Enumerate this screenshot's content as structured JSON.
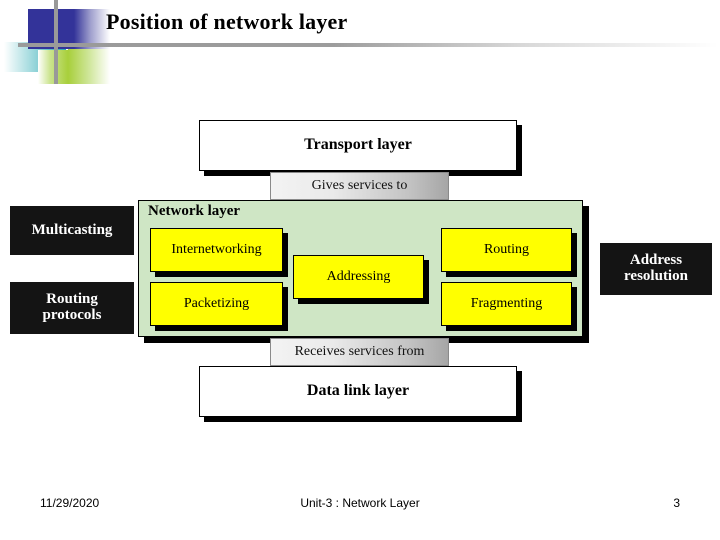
{
  "slide": {
    "title": "Position of network layer",
    "page_number": "3"
  },
  "diagram": {
    "upper_layer": "Transport layer",
    "upper_connector": "Gives services to",
    "network_layer_label": "Network layer",
    "lower_connector": "Receives services from",
    "lower_layer": "Data link layer",
    "functions": [
      {
        "label": "Internetworking"
      },
      {
        "label": "Packetizing"
      },
      {
        "label": "Addressing"
      },
      {
        "label": "Routing"
      },
      {
        "label": "Fragmenting"
      }
    ],
    "left_boxes": [
      {
        "line1": "Multicasting",
        "line2": ""
      },
      {
        "line1": "Routing",
        "line2": "protocols"
      }
    ],
    "right_boxes": [
      {
        "line1": "Address",
        "line2": "resolution"
      }
    ]
  },
  "footer": {
    "date": "11/29/2020",
    "center": "Unit-3 : Network Layer",
    "page": "3"
  },
  "colors": {
    "network_layer_fill": "#cfe6c5",
    "function_fill": "#ffff00",
    "side_box_fill": "#141414",
    "accent_blue": "#333399",
    "accent_green": "#a8cf3b",
    "accent_teal": "#2aa8b0"
  }
}
